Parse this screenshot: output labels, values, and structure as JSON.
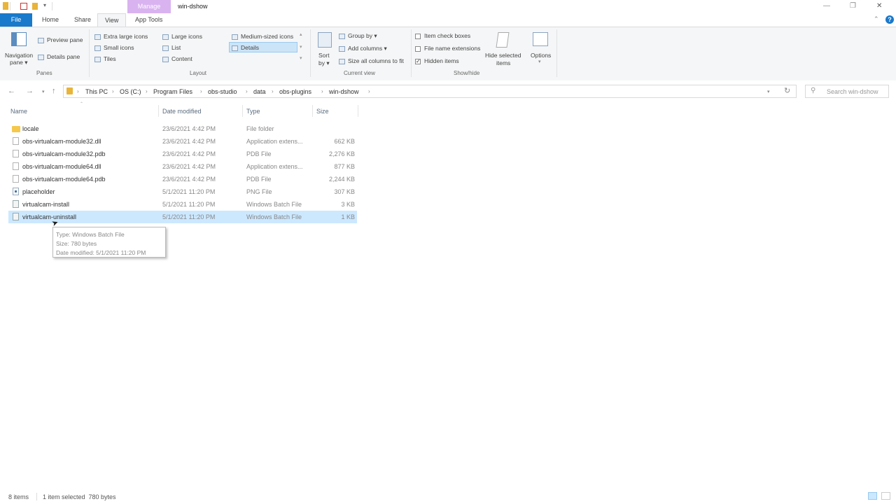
{
  "titlebar": {
    "manage_tab": "Manage",
    "title": "win-dshow",
    "quick_access_dropdown": "▾",
    "controls": {
      "minimize": "—",
      "maximize": "❐",
      "close": "✕"
    }
  },
  "ribbon_tabs": {
    "file": "File",
    "home": "Home",
    "share": "Share",
    "view": "View",
    "app_tools": "App Tools"
  },
  "ribbon": {
    "panes": {
      "navigation_pane": "Navigation",
      "navigation_pane_2": "pane ▾",
      "preview_pane": "Preview pane",
      "details_pane": "Details pane",
      "group_label": "Panes"
    },
    "layout": {
      "extra_large_icons": "Extra large icons",
      "large_icons": "Large icons",
      "medium_icons": "Medium-sized icons",
      "small_icons": "Small icons",
      "list": "List",
      "details": "Details",
      "tiles": "Tiles",
      "content": "Content",
      "group_label": "Layout"
    },
    "current_view": {
      "sort_by": "Sort",
      "sort_by_2": "by ▾",
      "group_by": "Group by ▾",
      "add_columns": "Add columns ▾",
      "size_all_columns": "Size all columns to fit",
      "group_label": "Current view"
    },
    "show_hide": {
      "item_check_boxes": "Item check boxes",
      "file_name_extensions": "File name extensions",
      "hidden_items": "Hidden items",
      "hidden_items_checked": true,
      "hide_selected": "Hide selected",
      "hide_selected_2": "items",
      "group_label": "Show/hide"
    },
    "options": {
      "label": "Options",
      "arrow": "▾"
    }
  },
  "address": {
    "crumbs": [
      "This PC",
      "OS (C:)",
      "Program Files",
      "obs-studio",
      "data",
      "obs-plugins",
      "win-dshow"
    ],
    "search_placeholder": "Search win-dshow"
  },
  "columns": {
    "name": "Name",
    "date": "Date modified",
    "type": "Type",
    "size": "Size"
  },
  "files": [
    {
      "name": "locale",
      "date": "23/6/2021 4:42 PM",
      "type": "File folder",
      "size": "",
      "icon": "folder"
    },
    {
      "name": "obs-virtualcam-module32.dll",
      "date": "23/6/2021 4:42 PM",
      "type": "Application extens...",
      "size": "662 KB",
      "icon": "file"
    },
    {
      "name": "obs-virtualcam-module32.pdb",
      "date": "23/6/2021 4:42 PM",
      "type": "PDB File",
      "size": "2,276 KB",
      "icon": "file"
    },
    {
      "name": "obs-virtualcam-module64.dll",
      "date": "23/6/2021 4:42 PM",
      "type": "Application extens...",
      "size": "877 KB",
      "icon": "file"
    },
    {
      "name": "obs-virtualcam-module64.pdb",
      "date": "23/6/2021 4:42 PM",
      "type": "PDB File",
      "size": "2,244 KB",
      "icon": "file"
    },
    {
      "name": "placeholder",
      "date": "5/1/2021 11:20 PM",
      "type": "PNG File",
      "size": "307 KB",
      "icon": "png"
    },
    {
      "name": "virtualcam-install",
      "date": "5/1/2021 11:20 PM",
      "type": "Windows Batch File",
      "size": "3 KB",
      "icon": "bat"
    },
    {
      "name": "virtualcam-uninstall",
      "date": "5/1/2021 11:20 PM",
      "type": "Windows Batch File",
      "size": "1 KB",
      "icon": "bat",
      "selected": true
    }
  ],
  "tooltip": {
    "type": "Type: Windows Batch File",
    "size": "Size: 780 bytes",
    "date": "Date modified: 5/1/2021 11:20 PM"
  },
  "status": {
    "items": "8 items",
    "selected": "1 item selected  780 bytes"
  },
  "colors": {
    "file_tab": "#1979ca",
    "manage_tab": "#d9b3f0",
    "selection": "#cce8ff",
    "folder": "#f5c84c"
  }
}
